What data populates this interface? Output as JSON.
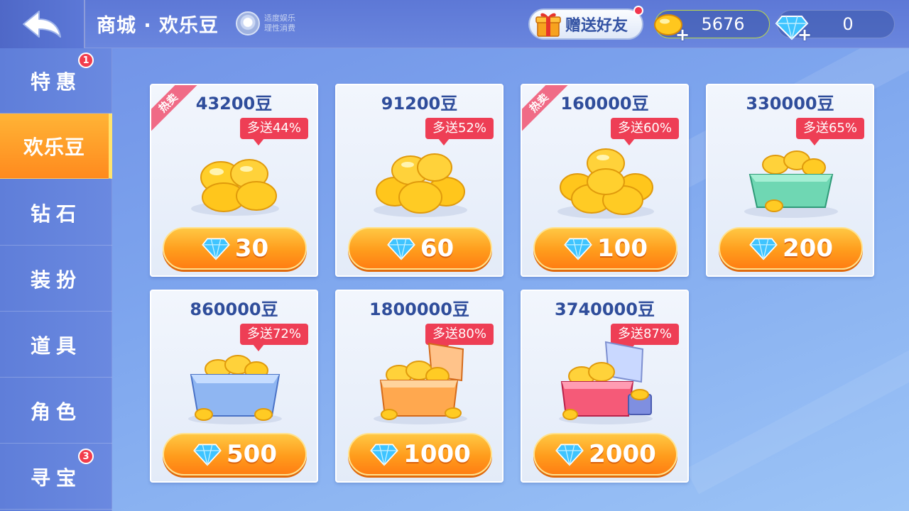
{
  "header": {
    "title": "商城 · 欢乐豆",
    "age_notice_line1": "适度娱乐",
    "age_notice_line2": "理性消费",
    "gift_label": "赠送好友",
    "beans_balance": "5676",
    "diamond_balance": "0",
    "plus_symbol": "+"
  },
  "sidebar": {
    "items": [
      {
        "label": "特惠",
        "badge": "1"
      },
      {
        "label": "欢乐豆",
        "badge": ""
      },
      {
        "label": "钻石",
        "badge": ""
      },
      {
        "label": "装扮",
        "badge": ""
      },
      {
        "label": "道具",
        "badge": ""
      },
      {
        "label": "角色",
        "badge": ""
      },
      {
        "label": "寻宝",
        "badge": "3"
      }
    ],
    "active": "欢乐豆"
  },
  "products": [
    {
      "amount": "43200豆",
      "bonus": "多送44%",
      "price": "30",
      "hot": "热卖",
      "art": "beans-small"
    },
    {
      "amount": "91200豆",
      "bonus": "多送52%",
      "price": "60",
      "hot": "",
      "art": "beans-medium"
    },
    {
      "amount": "160000豆",
      "bonus": "多送60%",
      "price": "100",
      "hot": "热卖",
      "art": "beans-large"
    },
    {
      "amount": "330000豆",
      "bonus": "多送65%",
      "price": "200",
      "hot": "",
      "art": "box-green"
    },
    {
      "amount": "860000豆",
      "bonus": "多送72%",
      "price": "500",
      "hot": "",
      "art": "box-blue"
    },
    {
      "amount": "1800000豆",
      "bonus": "多送80%",
      "price": "1000",
      "hot": "",
      "art": "chest-orange"
    },
    {
      "amount": "3740000豆",
      "bonus": "多送87%",
      "price": "2000",
      "hot": "",
      "art": "chest-red"
    }
  ],
  "colors": {
    "accent_orange": "#ff9c1c",
    "bonus_red": "#ee3e55",
    "hot_pink": "#f06b86",
    "title_blue": "#2f4d9b"
  },
  "icons": {
    "back": "back-arrow-icon",
    "bean": "bean-icon",
    "diamond": "diamond-icon",
    "gift": "gift-box-icon"
  }
}
